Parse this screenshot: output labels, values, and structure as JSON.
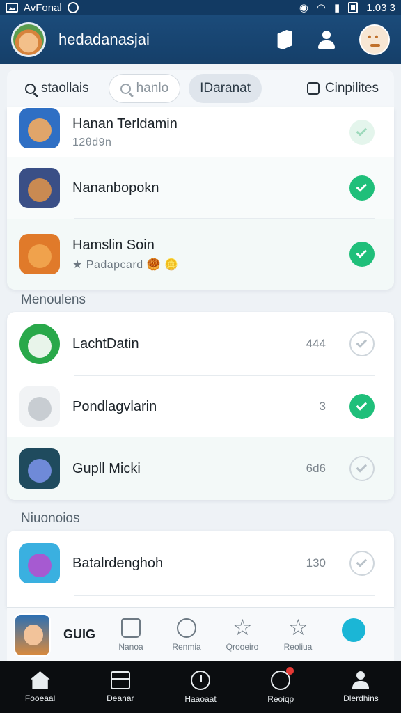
{
  "status_bar": {
    "carrier": "AvFonal",
    "time": "1.03 3"
  },
  "app_bar": {
    "title": "hedadanasjai"
  },
  "filters": {
    "search_label": "staollais",
    "search_placeholder": "hanlo",
    "active_label": "IDaranat",
    "checkbox_label": "Cinpilites"
  },
  "list1": [
    {
      "title": "Hanan Terldamin",
      "subtitle": "12θd9n",
      "state": "faint",
      "icon_bg": "#2f6fc4",
      "icon_face": "#e0a56a"
    },
    {
      "title": "Nananbopokn",
      "subtitle": "",
      "state": "on",
      "icon_bg": "#3a4f86",
      "icon_face": "#c98a52"
    },
    {
      "title": "Hamslin Soin",
      "subtitle": "★ Padapcard 🥮 🪙",
      "state": "on",
      "icon_bg": "#e07a2a",
      "icon_face": "#f0a24c"
    }
  ],
  "section2_label": "Menoulens",
  "list2": [
    {
      "title": "LachtDatin",
      "count": "444",
      "state": "off",
      "icon_bg": "#29a84a",
      "icon_face": "#e8f4ea"
    },
    {
      "title": "Pondlagvlarin",
      "count": "3",
      "state": "on",
      "icon_bg": "#f1f3f5",
      "icon_face": "#c8cdd2"
    },
    {
      "title": "Gupll Micki",
      "count": "6d6",
      "state": "off",
      "icon_bg": "#1f4b5e",
      "icon_face": "#6f8ad8"
    }
  ],
  "section3_label": "Niuonoios",
  "list3": [
    {
      "title": "Batalrdenghoh",
      "count": "130",
      "state": "off",
      "icon_bg": "#3ab0e0",
      "icon_face": "#a65ad1"
    }
  ],
  "mini_strip": {
    "label": "GUIG",
    "tabs": [
      {
        "label": "Nanoa",
        "icon": "bag-icon"
      },
      {
        "label": "Renmia",
        "icon": "dial-icon"
      },
      {
        "label": "Qrooeiro",
        "icon": "star-icon"
      },
      {
        "label": "Reoliua",
        "icon": "star-icon"
      },
      {
        "label": "",
        "icon": "cyan-action-icon"
      }
    ]
  },
  "bottom_nav": [
    {
      "label": "Fooeaal",
      "icon": "home-icon"
    },
    {
      "label": "Deanar",
      "icon": "card-icon"
    },
    {
      "label": "Haaoaat",
      "icon": "clock-icon"
    },
    {
      "label": "Reoiqp",
      "icon": "notification-icon"
    },
    {
      "label": "Dlerdhins",
      "icon": "user-icon"
    }
  ]
}
